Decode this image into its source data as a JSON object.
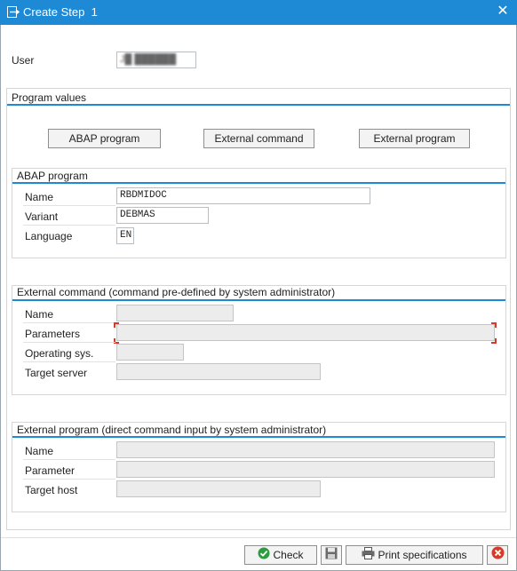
{
  "window": {
    "title": "Create Step  1",
    "close_glyph": "✕",
    "title_icon": "create-step-icon"
  },
  "user": {
    "label": "User",
    "value": "J█ ██████"
  },
  "program_values": {
    "title": "Program values",
    "buttons": {
      "abap": "ABAP program",
      "external_command": "External command",
      "external_program": "External program"
    }
  },
  "abap_program": {
    "title": "ABAP program",
    "name_label": "Name",
    "name_value": "RBDMIDOC",
    "variant_label": "Variant",
    "variant_value": "DEBMAS",
    "language_label": "Language",
    "language_value": "EN"
  },
  "external_command": {
    "title": "External command (command pre-defined by system administrator)",
    "name_label": "Name",
    "parameters_label": "Parameters",
    "operating_sys_label": "Operating sys.",
    "target_server_label": "Target server"
  },
  "external_program": {
    "title": "External program (direct command input by system administrator)",
    "name_label": "Name",
    "parameter_label": "Parameter",
    "target_host_label": "Target host"
  },
  "footer": {
    "check_label": "Check",
    "check_icon": "checkmark-circle-icon",
    "save_icon": "save-icon",
    "print_label": "Print specifications",
    "print_icon": "printer-icon",
    "cancel_icon": "cancel-icon",
    "colors": {
      "check_green": "#2e9b3e",
      "cancel_red": "#d43b2a",
      "accent_blue": "#1e8ad6"
    }
  }
}
